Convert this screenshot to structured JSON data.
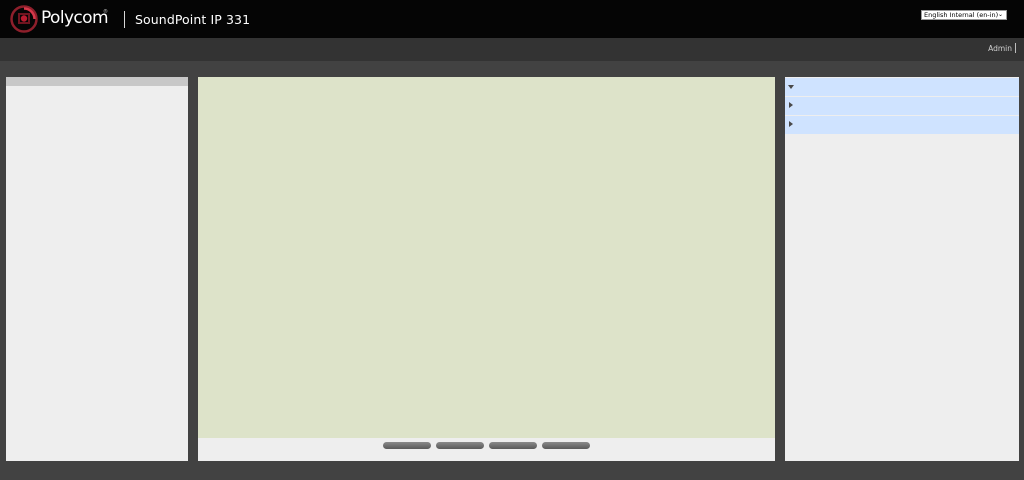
{
  "header": {
    "brand": "Polycom",
    "brand_tm": "®",
    "product": "SoundPoint IP 331",
    "language_select": {
      "selected": "English Internal (en-in)"
    },
    "logo_icon": "polycom-logo-icon"
  },
  "subbar": {
    "user": "Admin"
  },
  "phone": {
    "softkeys": [
      "",
      "",
      "",
      ""
    ]
  },
  "nav": {
    "items": [
      {
        "state": "expanded",
        "icon": "triangle-down-icon"
      },
      {
        "state": "collapsed",
        "icon": "triangle-right-icon"
      },
      {
        "state": "collapsed",
        "icon": "triangle-right-icon"
      }
    ]
  },
  "colors": {
    "header_bg": "#050505",
    "page_bg": "#424242",
    "subbar_bg": "#333333",
    "display_bg": "#dde3c9",
    "nav_row_bg": "#cfe3ff",
    "panel_bg": "#eeeeee",
    "logo_red": "#c8102e"
  }
}
